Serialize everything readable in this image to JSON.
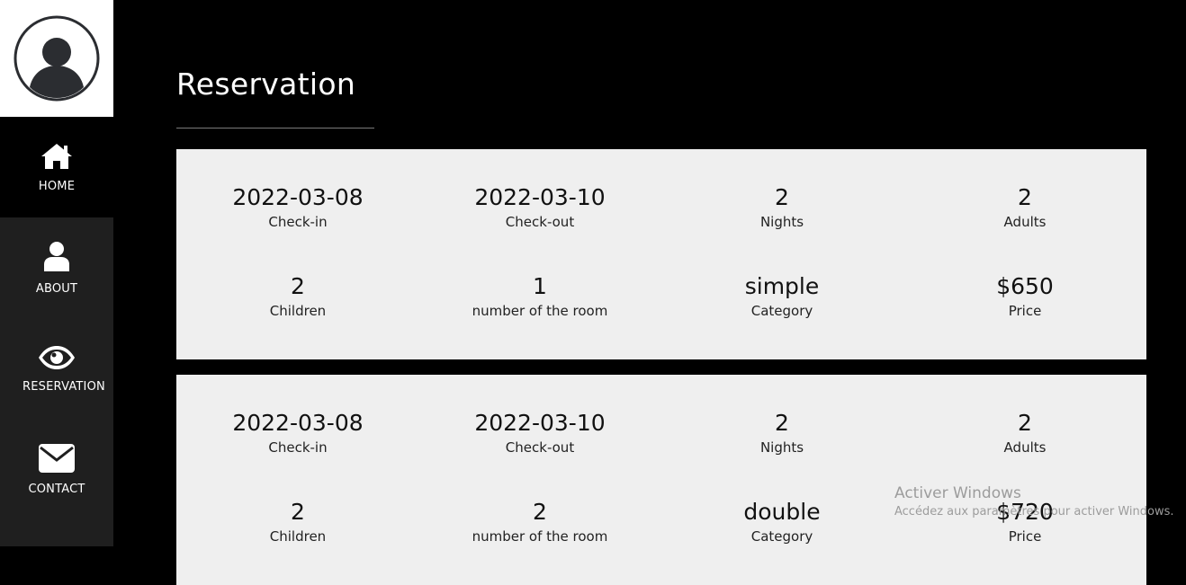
{
  "sidebar": {
    "items": [
      {
        "label": "HOME",
        "icon": "home-icon"
      },
      {
        "label": "ABOUT",
        "icon": "user-icon"
      },
      {
        "label": "RESERVATION",
        "icon": "eye-icon"
      },
      {
        "label": "CONTACT",
        "icon": "envelope-icon"
      }
    ],
    "avatar_icon": "avatar-icon"
  },
  "main": {
    "title": "Reservation",
    "reservations": [
      {
        "checkin": {
          "value": "2022-03-08",
          "label": "Check-in"
        },
        "checkout": {
          "value": "2022-03-10",
          "label": "Check-out"
        },
        "nights": {
          "value": "2",
          "label": "Nights"
        },
        "adults": {
          "value": "2",
          "label": "Adults"
        },
        "children": {
          "value": "2",
          "label": "Children"
        },
        "room": {
          "value": "1",
          "label": "number of the room"
        },
        "category": {
          "value": "simple",
          "label": "Category"
        },
        "price": {
          "value": "$650",
          "label": "Price"
        }
      },
      {
        "checkin": {
          "value": "2022-03-08",
          "label": "Check-in"
        },
        "checkout": {
          "value": "2022-03-10",
          "label": "Check-out"
        },
        "nights": {
          "value": "2",
          "label": "Nights"
        },
        "adults": {
          "value": "2",
          "label": "Adults"
        },
        "children": {
          "value": "2",
          "label": "Children"
        },
        "room": {
          "value": "2",
          "label": "number of the room"
        },
        "category": {
          "value": "double",
          "label": "Category"
        },
        "price": {
          "value": "$720",
          "label": "Price"
        }
      }
    ]
  },
  "watermark": {
    "title": "Activer Windows",
    "subtitle": "Accédez aux paramètres pour activer Windows."
  },
  "colors": {
    "background": "#000000",
    "sidebar": "#1f1f1f",
    "card": "#efefef",
    "text_light": "#ffffff"
  }
}
